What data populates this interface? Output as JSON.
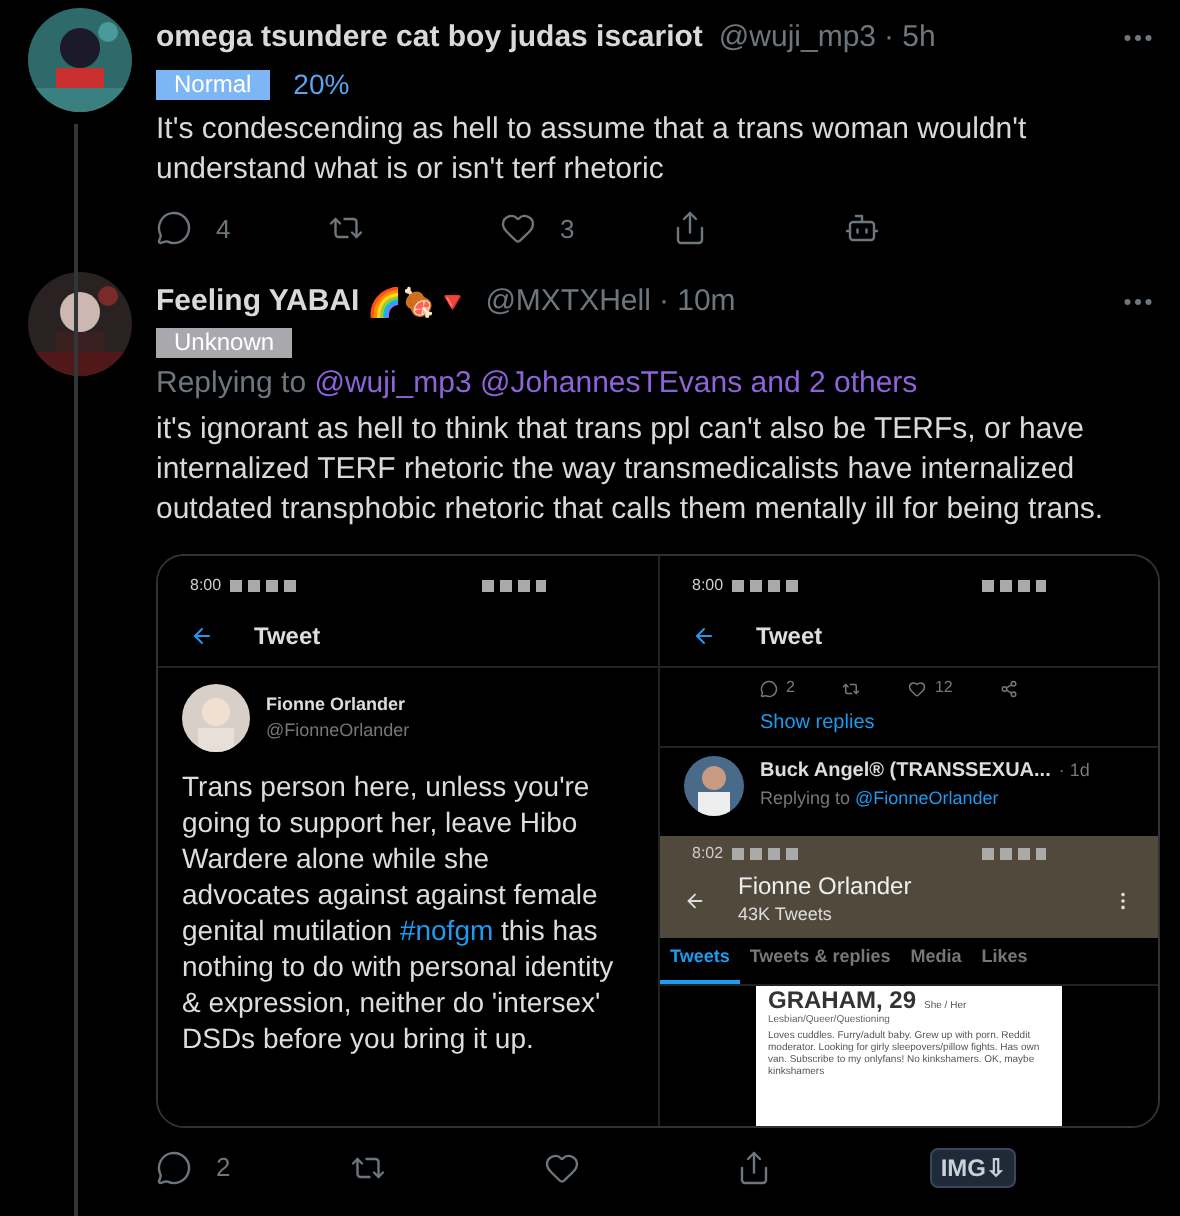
{
  "tweets": [
    {
      "name": "omega tsundere cat boy judas iscariot",
      "handle": "@wuji_mp3",
      "time": "· 5h",
      "badge": {
        "label": "Normal",
        "kind": "normal"
      },
      "score": "20%",
      "text": "It's condescending as hell to assume that a trans woman wouldn't understand what is or isn't terf rhetoric",
      "actions": [
        {
          "kind": "reply",
          "count": "4"
        },
        {
          "kind": "retweet"
        },
        {
          "kind": "like",
          "count": "3"
        },
        {
          "kind": "share"
        },
        {
          "kind": "bot"
        }
      ]
    },
    {
      "name": "Feeling YABAI",
      "emoji": "🌈🍖🔻",
      "handle": "@MXTXHell",
      "time": "· 10m",
      "badge": {
        "label": "Unknown",
        "kind": "unknown"
      },
      "replying_label": "Replying to",
      "replying_to": "@wuji_mp3 @JohannesTEvans and 2 others",
      "text": "it's ignorant as hell to think that trans ppl can't also be TERFs, or have internalized TERF rhetoric the way transmedicalists have internalized outdated transphobic rhetoric that calls them mentally ill for being trans.",
      "actions": [
        {
          "kind": "reply",
          "count": "2"
        },
        {
          "kind": "retweet"
        },
        {
          "kind": "like"
        },
        {
          "kind": "share"
        },
        {
          "kind": "img",
          "label": "IMG⇩"
        }
      ]
    }
  ],
  "embedded_left": {
    "clock": "8:00",
    "header": "Tweet",
    "author": "Fionne Orlander",
    "author_handle": "@FionneOrlander",
    "text_before": "Trans person here, unless you're going to support her, leave Hibo Wardere alone while she advocates against against female genital mutilation ",
    "hashtag": "#nofgm",
    "text_after": " this has nothing to do with personal identity & expression, neither do 'intersex' DSDs before you bring it up."
  },
  "embedded_right": {
    "clock": "8:00",
    "header": "Tweet",
    "reply_count": "2",
    "like_count": "12",
    "show_replies": "Show replies",
    "reply_author": "Buck Angel® (TRANSSEXUA...",
    "reply_time": "· 1d",
    "replying_label": "Replying to",
    "replying_to": "@FionneOrlander",
    "profile": {
      "clock": "8:02",
      "name": "Fionne Orlander",
      "tweet_count": "43K Tweets",
      "tabs": [
        {
          "label": "Tweets",
          "selected": true
        },
        {
          "label": "Tweets & replies",
          "selected": false
        },
        {
          "label": "Media",
          "selected": false
        },
        {
          "label": "Likes",
          "selected": false
        }
      ],
      "card": {
        "title": "GRAHAM, 29",
        "pronouns": "She / Her",
        "tags": "Lesbian/Queer/Questioning",
        "bio": "Loves cuddles. Furry/adult baby. Grew up with porn. Reddit moderator. Looking for girly sleepovers/pillow fights. Has own van. Subscribe to my onlyfans!  No kinkshamers. OK, maybe kinkshamers"
      }
    }
  }
}
